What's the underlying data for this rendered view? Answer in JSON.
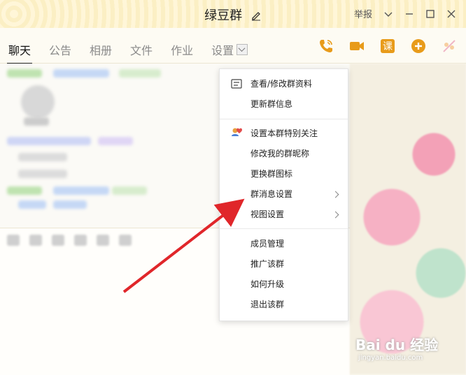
{
  "window": {
    "title": "绿豆群",
    "report": "举报"
  },
  "tabs": [
    {
      "label": "聊天",
      "active": true
    },
    {
      "label": "公告"
    },
    {
      "label": "相册"
    },
    {
      "label": "文件"
    },
    {
      "label": "作业"
    },
    {
      "label": "设置"
    }
  ],
  "toolbar_icons": [
    "phone-icon",
    "video-icon",
    "course-icon",
    "add-icon",
    "more-icon"
  ],
  "course_icon_char": "课",
  "menu": {
    "group1": [
      "查看/修改群资料",
      "更新群信息"
    ],
    "group2": [
      "设置本群特别关注",
      "修改我的群昵称",
      "更换群图标",
      "群消息设置",
      "视图设置"
    ],
    "group3": [
      "成员管理",
      "推广该群",
      "如何升级",
      "退出该群"
    ]
  },
  "watermark": {
    "brand": "Bai du 经验",
    "url": "jingyan.baidu.com"
  },
  "colors": {
    "accent_orange": "#e89b1a",
    "arrow_red": "#e0262a",
    "title_bg": "#fcf2cf"
  }
}
